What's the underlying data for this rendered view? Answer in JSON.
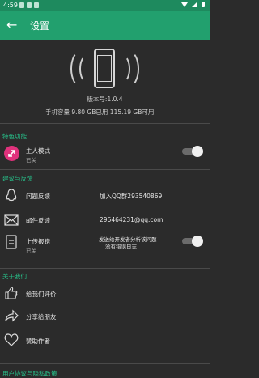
{
  "status": {
    "time": "4:59"
  },
  "appbar": {
    "back": "←",
    "title": "设置"
  },
  "app_info": {
    "version": "版本号:1.0.4",
    "storage": "手机容量   9.80 GB已用    115.19 GB可用"
  },
  "features": {
    "header": "特色功能",
    "host_mode": {
      "label": "主人模式",
      "sub": "已关"
    }
  },
  "feedback": {
    "header": "建议与反馈",
    "qq": {
      "label": "问题反馈",
      "value": "加入QQ群293540869"
    },
    "mail": {
      "label": "邮件反馈",
      "value": "296464231@qq.com"
    },
    "report": {
      "label": "上传报错",
      "sub": "已关",
      "value_line1": "发送给开发者分析该问题",
      "value_line2": "没有错误日志"
    }
  },
  "about": {
    "header": "关于我们",
    "rate": {
      "label": "给我们评价"
    },
    "share": {
      "label": "分享给朋友"
    },
    "sponsor": {
      "label": "赞助作者"
    }
  },
  "footer": {
    "header": "用户协议与隐私政策"
  },
  "colors": {
    "accent": "#22a06e",
    "section": "#27c08a",
    "pink": "#e0327c"
  }
}
